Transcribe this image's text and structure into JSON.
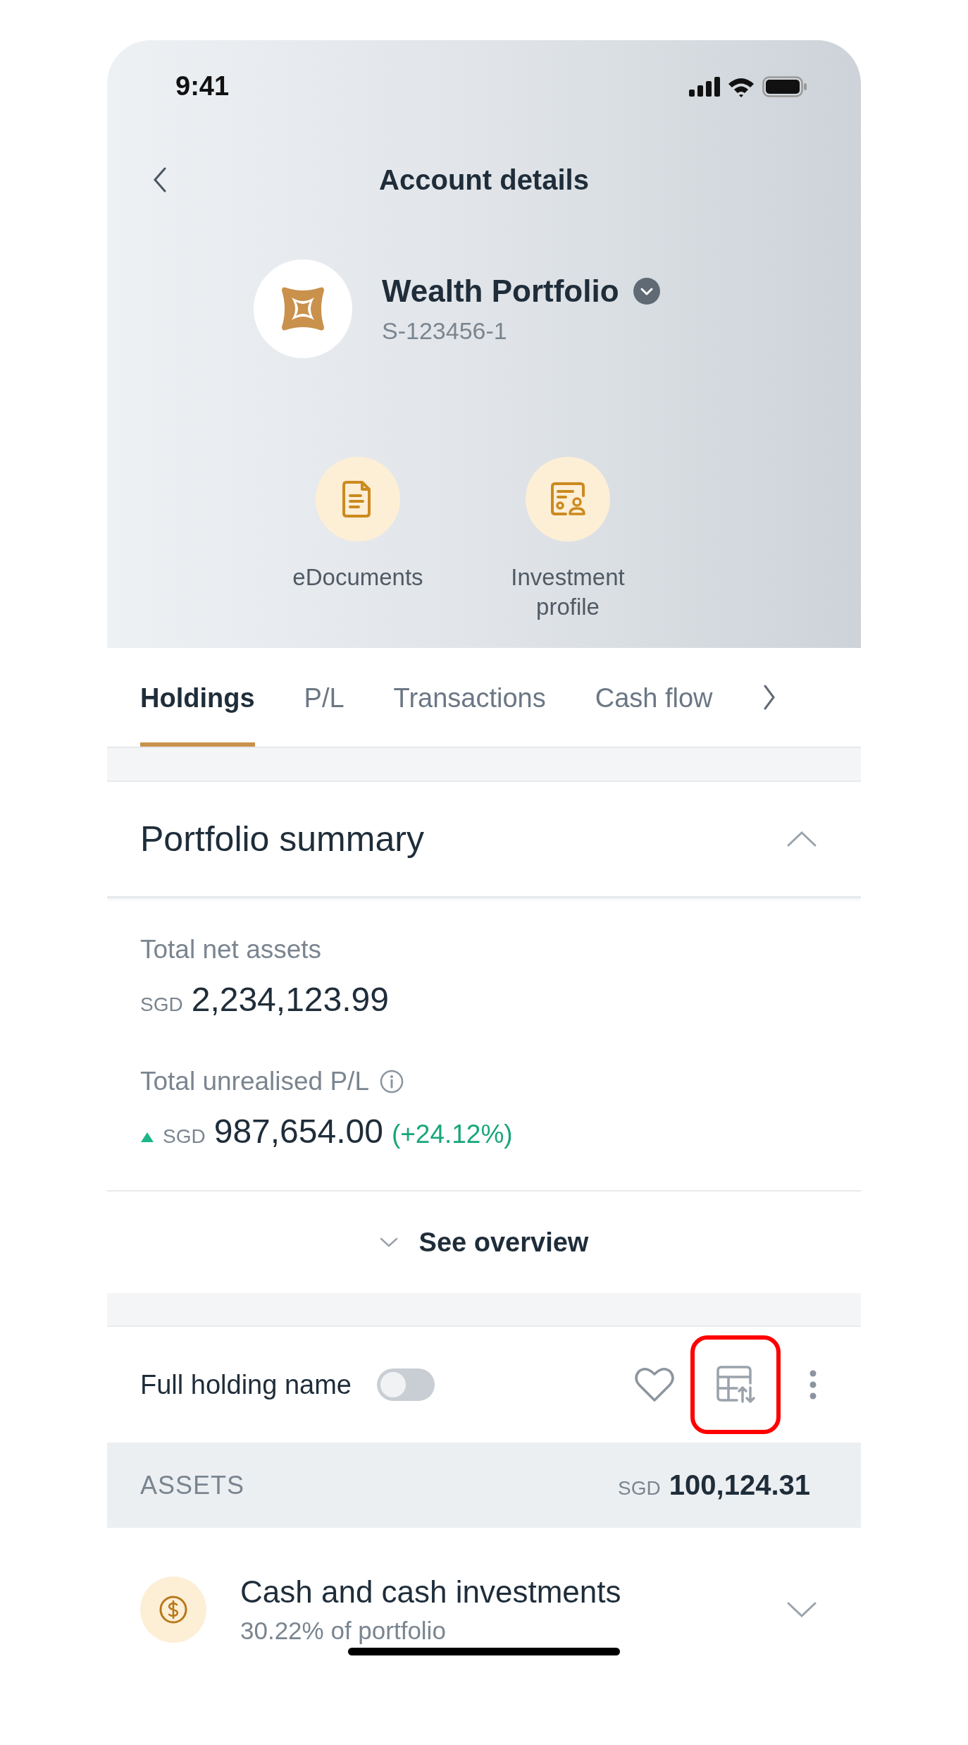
{
  "status_bar": {
    "time": "9:41"
  },
  "header": {
    "title": "Account details"
  },
  "account": {
    "name": "Wealth Portfolio",
    "number": "S-123456-1"
  },
  "actions": [
    {
      "label": "eDocuments",
      "kind": "document"
    },
    {
      "label": "Investment profile",
      "kind": "profile"
    }
  ],
  "tabs": [
    {
      "label": "Holdings",
      "selected": true
    },
    {
      "label": "P/L",
      "selected": false
    },
    {
      "label": "Transactions",
      "selected": false
    },
    {
      "label": "Cash flow",
      "selected": false
    }
  ],
  "summary": {
    "title": "Portfolio summary",
    "expanded": true,
    "net_assets": {
      "label": "Total net assets",
      "currency": "SGD",
      "value": "2,234,123.99"
    },
    "unrealised": {
      "label": "Total unrealised P/L",
      "currency": "SGD",
      "value": "987,654.00",
      "change": "(+24.12%)",
      "gain": true
    },
    "overview": "See overview"
  },
  "holdings_toolbar": {
    "label": "Full holding name",
    "on": false
  },
  "assets": {
    "label": "ASSETS",
    "currency": "SGD",
    "total": "100,124.31"
  },
  "categories": [
    {
      "name": "Cash and cash investments",
      "share": "30.22% of portfolio",
      "expanded": false
    }
  ]
}
